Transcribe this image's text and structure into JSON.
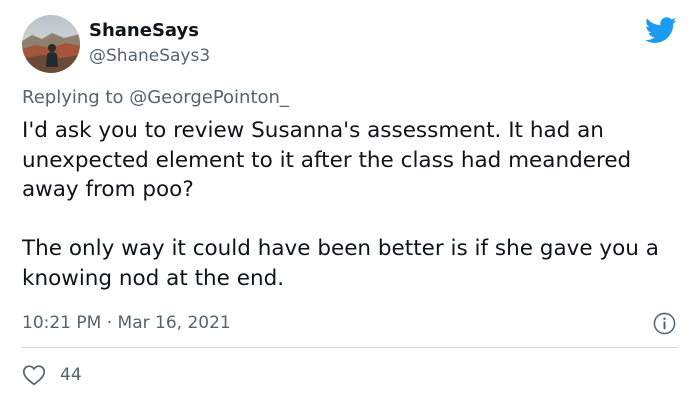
{
  "author": {
    "display_name": "ShaneSays",
    "handle": "@ShaneSays3",
    "avatar_icon": "profile-photo-landscape"
  },
  "reply": {
    "prefix": "Replying to ",
    "mention": "@GeorgePointon_"
  },
  "body": {
    "paragraph_1": "I'd ask you to review Susanna's assessment. It had an unexpected element to it after the class had meandered away from poo?",
    "paragraph_2": "The only way it could have been better is if she gave you a knowing nod at the end."
  },
  "meta": {
    "time": "10:21 PM",
    "separator": " · ",
    "date": "Mar 16, 2021"
  },
  "actions": {
    "like_count": "44"
  },
  "colors": {
    "brand": "#1d9bf0",
    "text": "#0f1419",
    "secondary": "#536471",
    "divider": "#cfd9de"
  },
  "icons": {
    "logo": "twitter-bird-icon",
    "info": "info-icon",
    "like": "heart-icon"
  }
}
